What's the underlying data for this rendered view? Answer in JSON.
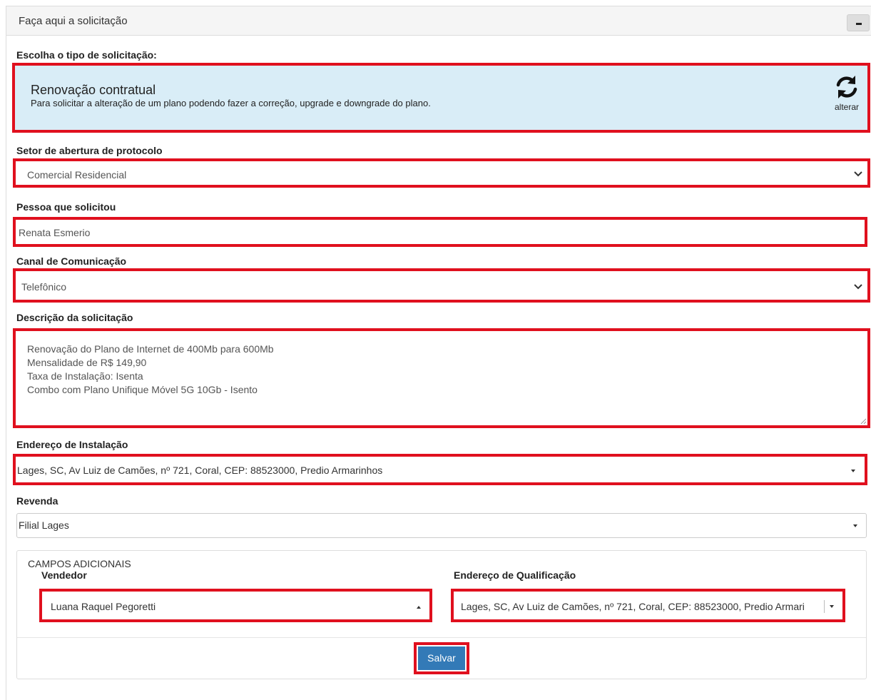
{
  "panel": {
    "title": "Faça aqui a solicitação",
    "collapse_icon": "minus-icon"
  },
  "request_type": {
    "label": "Escolha o tipo de solicitação:",
    "title": "Renovação contratual",
    "description": "Para solicitar a alteração de um plano podendo fazer a correção, upgrade e downgrade do plano.",
    "change_label": "alterar",
    "change_icon": "refresh-icon"
  },
  "sector": {
    "label": "Setor de abertura de protocolo",
    "value": "Comercial Residencial"
  },
  "requester": {
    "label": "Pessoa que solicitou",
    "value": "Renata Esmerio"
  },
  "channel": {
    "label": "Canal de Comunicação",
    "value": "Telefônico"
  },
  "description": {
    "label": "Descrição da solicitação",
    "lines": [
      "Renovação do Plano de Internet de 400Mb para 600Mb",
      "Mensalidade de R$ 149,90",
      "Taxa de Instalação: Isenta",
      "Combo com Plano Unifique Móvel 5G 10Gb - Isento"
    ]
  },
  "install_address": {
    "label": "Endereço de Instalação",
    "value": "Lages, SC, Av Luiz de Camões, nº 721, Coral, CEP: 88523000, Predio Armarinhos"
  },
  "reseller": {
    "label": "Revenda",
    "value": "Filial Lages"
  },
  "additional": {
    "title": "CAMPOS ADICIONAIS",
    "seller_label": "Vendedor",
    "seller_value": "Luana Raquel Pegoretti",
    "qual_label": "Endereço de Qualificação",
    "qual_value": "Lages, SC, Av Luiz de Camões, nº 721, Coral, CEP: 88523000, Predio Armari"
  },
  "save_label": "Salvar",
  "colors": {
    "highlight": "#e0101e",
    "card_bg": "#d9edf7",
    "primary": "#337ab7"
  }
}
